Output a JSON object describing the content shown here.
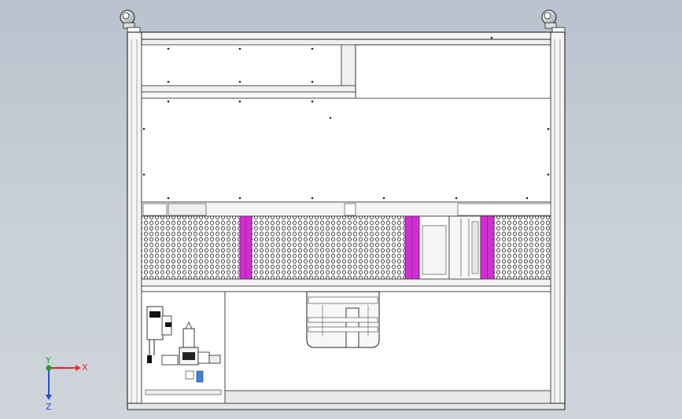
{
  "view": {
    "triad": {
      "x_label": "X",
      "y_label": "Y",
      "z_label": "Z"
    },
    "colors": {
      "background": "#c4ccd5",
      "frame_fill": "#f2f3f4",
      "edge": "#2b2b2b",
      "panel_fill": "#ffffff",
      "magenta_strip": "#d22fd2",
      "x_axis": "#e03030",
      "y_axis": "#22a022",
      "z_axis": "#2550d0"
    }
  }
}
